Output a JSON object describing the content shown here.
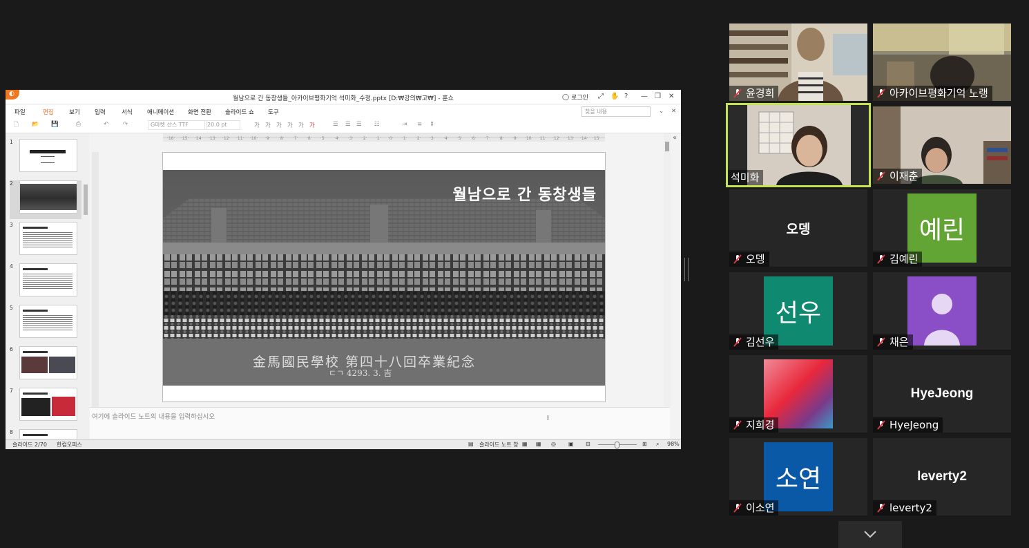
{
  "app": {
    "title": "월남으로 간 동창생들_아카이브평화기억 석미화_수정.pptx [D:₩강의₩고₩] - 훈쇼",
    "login_label": "로그인",
    "logo": "orange-app-logo",
    "menus": [
      "파일",
      "편집",
      "보기",
      "입력",
      "서식",
      "애니메이션",
      "화면 전환",
      "슬라이드 쇼",
      "도구"
    ],
    "active_menu": "편집",
    "find_placeholder": "찾을 내용",
    "font_name": "G마켓 산스 TTF",
    "font_size": "20.0",
    "font_unit": "pt",
    "notes_placeholder": "여기에 슬라이드 노트의 내용을 입력하십시오",
    "status_slide": "슬라이드 2/70",
    "status_lang": "한컴오피스",
    "status_notes": "슬라이드 노트 창",
    "zoom": "98%",
    "accent_color": "#e8702a"
  },
  "thumbnails": [
    {
      "num": "1",
      "title": "월남으로 간 동창생들"
    },
    {
      "num": "2",
      "title": "월남으로 간 동창생들"
    },
    {
      "num": "3",
      "title": ""
    },
    {
      "num": "4",
      "title": ""
    },
    {
      "num": "5",
      "title": ""
    },
    {
      "num": "6",
      "title": ""
    },
    {
      "num": "7",
      "title": ""
    },
    {
      "num": "8",
      "title": ""
    }
  ],
  "slide": {
    "title": "월남으로 간 동창생들",
    "caption_line1": "金馬國民學校 第四十八回卒業紀念",
    "caption_line2": "ㄷㄱ 4293. 3. 吉"
  },
  "participants": [
    {
      "name": "윤경희",
      "type": "video",
      "muted": true
    },
    {
      "name": "아카이브평화기억 노랭",
      "type": "video",
      "muted": true
    },
    {
      "name": "석미화",
      "type": "video",
      "muted": false,
      "active": true
    },
    {
      "name": "이재춘",
      "type": "video",
      "muted": true
    },
    {
      "name": "오뎅",
      "type": "text",
      "display": "오뎅",
      "muted": true
    },
    {
      "name": "김예린",
      "type": "avatar",
      "display": "예린",
      "color": "#62a534",
      "muted": true
    },
    {
      "name": "김선우",
      "type": "avatar",
      "display": "선우",
      "color": "#0f8a71",
      "muted": true
    },
    {
      "name": "채은",
      "type": "avatar-icon",
      "color": "#8a4fc6",
      "muted": true
    },
    {
      "name": "지희경",
      "type": "avatar-image",
      "muted": true
    },
    {
      "name": "HyeJeong",
      "type": "text",
      "display": "HyeJeong",
      "muted": true
    },
    {
      "name": "이소연",
      "type": "avatar",
      "display": "소연",
      "color": "#0a59a6",
      "muted": true
    },
    {
      "name": "leverty2",
      "type": "text",
      "display": "leverty2",
      "muted": true
    }
  ]
}
